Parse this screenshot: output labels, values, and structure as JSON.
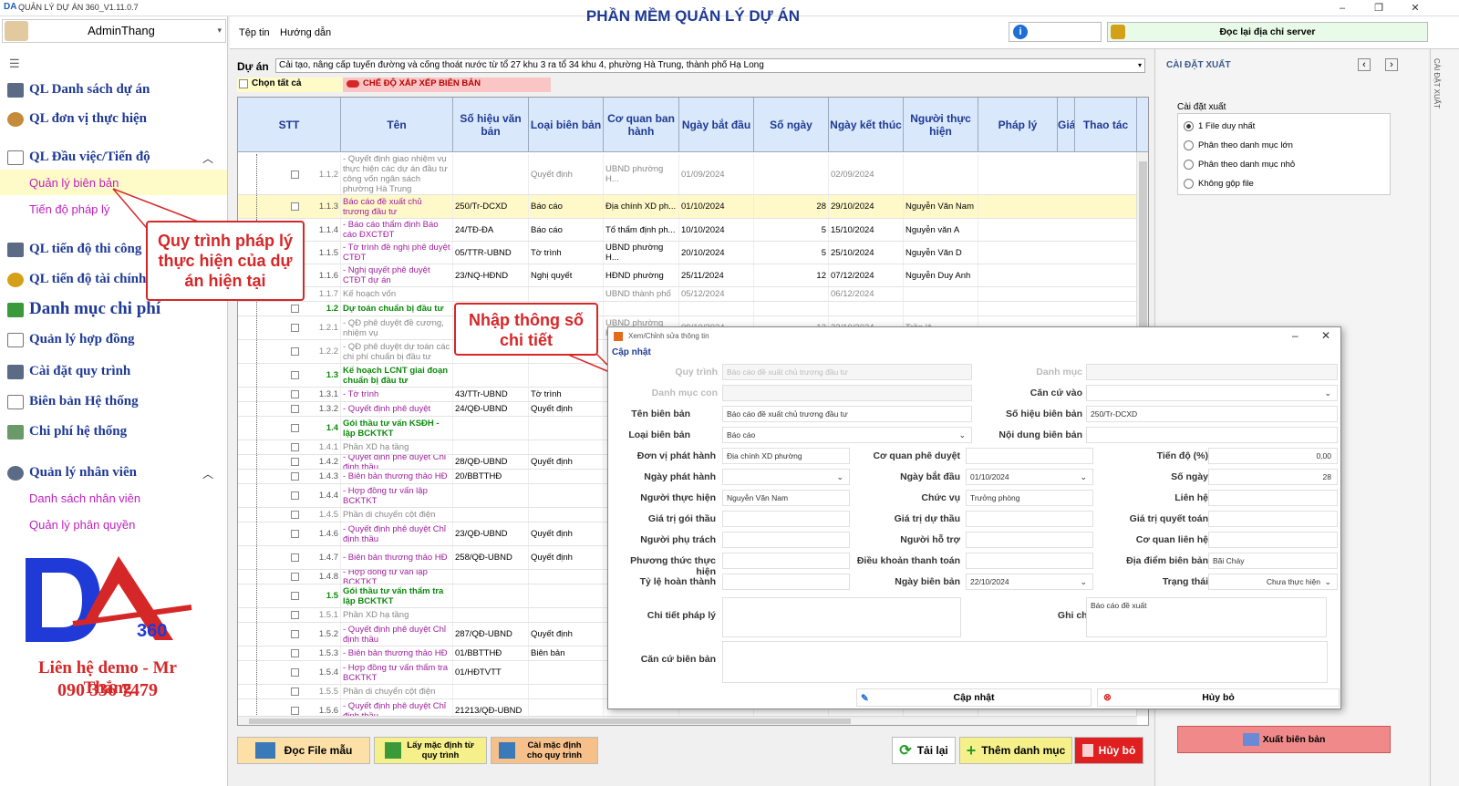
{
  "window": {
    "title": "QUẢN LÝ DỰ ÁN 360_V1.11.0.7",
    "minimize": "–",
    "maximize": "❐",
    "close": "✕"
  },
  "user": {
    "name": "AdminThang"
  },
  "topmenu": {
    "file": "Tệp tin",
    "help": "Hướng dẫn",
    "title": "PHẦN MỀM QUẢN LÝ DỰ ÁN",
    "server_btn": "Đọc lại địa chỉ server"
  },
  "sidebar": {
    "projects": "QL Danh sách dự án",
    "units": "QL đơn vị thực hiện",
    "tasks": "QL Đầu việc/Tiến độ",
    "minutes": "Quản lý biên bản",
    "legal": "Tiến độ pháp lý",
    "construction": "QL tiến độ thi công",
    "finance": "QL tiến độ tài chính",
    "costs": "Danh mục chi phí",
    "contracts": "Quản lý hợp đồng",
    "process": "Cài đặt quy trình",
    "sysminutes": "Biên bản Hệ thống",
    "syscost": "Chi phí hệ thống",
    "staff": "Quản lý nhân viên",
    "stafflist": "Danh sách nhân viên",
    "perm": "Quản lý phân quyền",
    "contact1": "Liên hệ demo - Mr Thắng",
    "contact2": "090 336 7479",
    "logo_num": "360"
  },
  "callouts": {
    "left": "Quy trình pháp lý thực hiện của dự án hiện tại",
    "mid": "Nhập thông số chi tiết"
  },
  "project": {
    "label": "Dự án",
    "value": "Cải tạo, nâng cấp tuyến đường và cống thoát nước từ tổ 27 khu 3 ra tổ 34 khu 4, phường Hà Trung, thành phố Hạ Long",
    "select_all": "Chọn tất cả",
    "sort_mode": "CHẾ ĐỘ XẮP XẾP BIÊN BẢN"
  },
  "grid": {
    "headers": [
      "STT",
      "Tên",
      "Số hiệu văn bản",
      "Loại biên bản",
      "Cơ quan ban hành",
      "Ngày bắt đầu",
      "Số ngày",
      "Ngày kết thúc",
      "Người thực hiện",
      "Pháp lý",
      "Giá",
      "Thao tác"
    ],
    "rows": [
      {
        "stt": "1.1.2",
        "name": "- Quyết định giao nhiệm vụ thực hiện các dự án đầu tư công vốn ngân sách phường Hà Trung",
        "so": "",
        "loai": "Quyết định",
        "cq": "UBND phường H...",
        "nbd": "01/09/2024",
        "sn": "",
        "nkt": "02/09/2024",
        "nth": "",
        "t": "grey"
      },
      {
        "stt": "1.1.3",
        "name": "Báo cáo đề xuất chủ trương đầu tư",
        "so": "250/Tr-DCXD",
        "loai": "Báo cáo",
        "cq": "Địa chính XD ph...",
        "nbd": "01/10/2024",
        "sn": "28",
        "nkt": "29/10/2024",
        "nth": "Nguyễn Văn Nam",
        "t": "hl"
      },
      {
        "stt": "1.1.4",
        "name": "- Báo cáo thẩm định Báo cáo ĐXCTĐT",
        "so": "24/TĐ-ĐA",
        "loai": "Báo cáo",
        "cq": "Tổ thẩm định ph...",
        "nbd": "10/10/2024",
        "sn": "5",
        "nkt": "15/10/2024",
        "nth": "Nguyễn văn A",
        "t": ""
      },
      {
        "stt": "1.1.5",
        "name": "- Tờ trình đề nghị phê duyệt CTĐT",
        "so": "05/TTR-UBND",
        "loai": "Tờ trình",
        "cq": "UBND phường H...",
        "nbd": "20/10/2024",
        "sn": "5",
        "nkt": "25/10/2024",
        "nth": "Nguyễn Văn D",
        "t": ""
      },
      {
        "stt": "1.1.6",
        "name": "- Nghị quyết phê duyệt CTĐT dự án",
        "so": "23/NQ-HĐND",
        "loai": "Nghị quyết",
        "cq": "HĐND phường",
        "nbd": "25/11/2024",
        "sn": "12",
        "nkt": "07/12/2024",
        "nth": "Nguyễn Duy Anh",
        "t": ""
      },
      {
        "stt": "1.1.7",
        "name": "Kế hoạch vốn",
        "so": "",
        "loai": "",
        "cq": "UBND thành phố",
        "nbd": "05/12/2024",
        "sn": "",
        "nkt": "06/12/2024",
        "nth": "",
        "t": "grey"
      },
      {
        "stt": "1.2",
        "name": "Dự toán chuẩn bị đầu tư",
        "so": "",
        "loai": "",
        "cq": "",
        "nbd": "",
        "sn": "",
        "nkt": "",
        "nth": "",
        "t": "grp"
      },
      {
        "stt": "1.2.1",
        "name": "- QĐ phê duyệt đề cương, nhiệm vụ",
        "so": "",
        "loai": "",
        "cq": "UBND phường H...",
        "nbd": "09/10/2024",
        "sn": "13",
        "nkt": "22/10/2024",
        "nth": "Trần lệ",
        "t": "grey"
      },
      {
        "stt": "1.2.2",
        "name": "- QĐ phê duyệt dự toán các chi phí chuẩn bị đầu tư",
        "so": "",
        "loai": "",
        "cq": "",
        "nbd": "",
        "sn": "",
        "nkt": "",
        "nth": "",
        "t": "grey"
      },
      {
        "stt": "1.3",
        "name": "Kế hoạch LCNT giai đoạn chuẩn bị đầu tư",
        "so": "",
        "loai": "",
        "cq": "",
        "nbd": "",
        "sn": "",
        "nkt": "",
        "nth": "",
        "t": "grp"
      },
      {
        "stt": "1.3.1",
        "name": "- Tờ trình",
        "so": "43/TTr-UBND",
        "loai": "Tờ trình",
        "cq": "",
        "nbd": "",
        "sn": "",
        "nkt": "",
        "nth": "",
        "t": ""
      },
      {
        "stt": "1.3.2",
        "name": "- Quyết định phê duyệt",
        "so": "24/QĐ-UBND",
        "loai": "Quyết định",
        "cq": "",
        "nbd": "",
        "sn": "",
        "nkt": "",
        "nth": "",
        "t": ""
      },
      {
        "stt": "1.4",
        "name": "Gói thầu tư vấn KSĐH - lập BCKTKT",
        "so": "",
        "loai": "",
        "cq": "",
        "nbd": "",
        "sn": "",
        "nkt": "",
        "nth": "",
        "t": "grp"
      },
      {
        "stt": "1.4.1",
        "name": "Phần XD hạ tầng",
        "so": "",
        "loai": "",
        "cq": "",
        "nbd": "",
        "sn": "",
        "nkt": "",
        "nth": "",
        "t": "grey"
      },
      {
        "stt": "1.4.2",
        "name": "- Quyết định phê duyệt Chỉ định thầu",
        "so": "28/QĐ-UBND",
        "loai": "Quyết định",
        "cq": "",
        "nbd": "",
        "sn": "",
        "nkt": "",
        "nth": "",
        "t": ""
      },
      {
        "stt": "1.4.3",
        "name": "- Biên bản thương thảo HĐ",
        "so": "20/BBTTHĐ",
        "loai": "",
        "cq": "",
        "nbd": "",
        "sn": "",
        "nkt": "",
        "nth": "",
        "t": ""
      },
      {
        "stt": "1.4.4",
        "name": "- Hợp đồng tư vấn lập BCKTKT",
        "so": "",
        "loai": "",
        "cq": "",
        "nbd": "",
        "sn": "",
        "nkt": "",
        "nth": "",
        "t": ""
      },
      {
        "stt": "1.4.5",
        "name": "Phần di chuyển cột điện",
        "so": "",
        "loai": "",
        "cq": "",
        "nbd": "",
        "sn": "",
        "nkt": "",
        "nth": "",
        "t": "grey"
      },
      {
        "stt": "1.4.6",
        "name": "- Quyết định phê duyệt Chỉ định thầu",
        "so": "23/QĐ-UBND",
        "loai": "Quyết định",
        "cq": "",
        "nbd": "",
        "sn": "",
        "nkt": "",
        "nth": "",
        "t": ""
      },
      {
        "stt": "1.4.7",
        "name": "- Biên bản thương thảo HĐ",
        "so": "258/QĐ-UBND",
        "loai": "Quyết định",
        "cq": "",
        "nbd": "",
        "sn": "",
        "nkt": "",
        "nth": "",
        "t": ""
      },
      {
        "stt": "1.4.8",
        "name": "- Hợp đồng tư vấn lập BCKTKT",
        "so": "",
        "loai": "",
        "cq": "",
        "nbd": "",
        "sn": "",
        "nkt": "",
        "nth": "",
        "t": ""
      },
      {
        "stt": "1.5",
        "name": "Gói thầu tư vấn thẩm tra lập BCKTKT",
        "so": "",
        "loai": "",
        "cq": "",
        "nbd": "",
        "sn": "",
        "nkt": "",
        "nth": "",
        "t": "grp"
      },
      {
        "stt": "1.5.1",
        "name": "Phần XD hạ tầng",
        "so": "",
        "loai": "",
        "cq": "",
        "nbd": "",
        "sn": "",
        "nkt": "",
        "nth": "",
        "t": "grey"
      },
      {
        "stt": "1.5.2",
        "name": "- Quyết định phê duyệt Chỉ định thầu",
        "so": "287/QĐ-UBND",
        "loai": "Quyết định",
        "cq": "",
        "nbd": "",
        "sn": "",
        "nkt": "",
        "nth": "",
        "t": ""
      },
      {
        "stt": "1.5.3",
        "name": "- Biên bản thương thảo HĐ",
        "so": "01/BBTTHĐ",
        "loai": "Biên bản",
        "cq": "",
        "nbd": "",
        "sn": "",
        "nkt": "",
        "nth": "",
        "t": ""
      },
      {
        "stt": "1.5.4",
        "name": "- Hợp đồng tư vấn thẩm tra BCKTKT",
        "so": "01/HĐTVTT",
        "loai": "",
        "cq": "",
        "nbd": "",
        "sn": "",
        "nkt": "",
        "nth": "",
        "t": ""
      },
      {
        "stt": "1.5.5",
        "name": "Phần di chuyển cột điện",
        "so": "",
        "loai": "",
        "cq": "",
        "nbd": "",
        "sn": "",
        "nkt": "",
        "nth": "",
        "t": "grey"
      },
      {
        "stt": "1.5.6",
        "name": "- Quyết định phê duyệt Chỉ định thầu",
        "so": "21213/QĐ-UBND",
        "loai": "",
        "cq": "",
        "nbd": "",
        "sn": "",
        "nkt": "",
        "nth": "",
        "t": ""
      }
    ]
  },
  "bottom": {
    "read_tpl": "Đọc File mẫu",
    "get_default": "Lấy mặc định từ quy trình",
    "set_default": "Cài mặc định cho quy trình",
    "reload": "Tải lại",
    "add": "Thêm danh mục",
    "cancel": "Hủy bỏ"
  },
  "export": {
    "title": "CÀI ĐẶT XUẤT",
    "vtitle": "CÀI ĐẶT XUẤT",
    "group": "Cài đặt xuất",
    "opts": [
      "1 File duy nhất",
      "Phân theo danh mục lớn",
      "Phân theo danh mục nhỏ",
      "Không gộp file"
    ],
    "btn": "Xuất biên bản"
  },
  "dialog": {
    "title": "Xem/Chỉnh sửa thông tin",
    "section": "Cập nhật",
    "f": {
      "quytrinh": {
        "l": "Quy trình",
        "v": "Báo cáo đề xuất chủ trương đầu tư"
      },
      "danhmuc": {
        "l": "Danh mục",
        "v": ""
      },
      "danhmuccon": {
        "l": "Danh mục con",
        "v": ""
      },
      "cancu": {
        "l": "Căn cứ vào",
        "v": ""
      },
      "ten": {
        "l": "Tên biên bản",
        "v": "Báo cáo đề xuất chủ trương đầu tư"
      },
      "sohieu": {
        "l": "Số hiệu biên bản",
        "v": "250/Tr-DCXD"
      },
      "loai": {
        "l": "Loại biên bản",
        "v": "Báo cáo"
      },
      "noidung": {
        "l": "Nội dung biên bản",
        "v": ""
      },
      "donvi": {
        "l": "Đơn vị phát hành",
        "v": "Địa chính XD phường"
      },
      "cqpd": {
        "l": "Cơ quan phê duyệt",
        "v": ""
      },
      "tiendo": {
        "l": "Tiến độ (%)",
        "v": "0,00"
      },
      "ngayph": {
        "l": "Ngày phát hành",
        "v": ""
      },
      "ngaybd": {
        "l": "Ngày bắt đầu",
        "v": "01/10/2024"
      },
      "songay": {
        "l": "Số ngày",
        "v": "28"
      },
      "nguoith": {
        "l": "Người thực hiện",
        "v": "Nguyễn Văn Nam"
      },
      "chucvu": {
        "l": "Chức vụ",
        "v": "Trưởng phòng"
      },
      "lienhe": {
        "l": "Liên hệ",
        "v": ""
      },
      "gtgoi": {
        "l": "Giá trị gói thầu",
        "v": ""
      },
      "gtdu": {
        "l": "Giá trị dự thầu",
        "v": ""
      },
      "gtqt": {
        "l": "Giá trị quyết toán",
        "v": ""
      },
      "nguoipt": {
        "l": "Người phụ trách",
        "v": ""
      },
      "nguoiht": {
        "l": "Người hỗ trợ",
        "v": ""
      },
      "cqlh": {
        "l": "Cơ quan liên hệ",
        "v": ""
      },
      "ptth": {
        "l": "Phương thức thực hiện",
        "v": ""
      },
      "dktt": {
        "l": "Điều khoản thanh toán",
        "v": ""
      },
      "diadiem": {
        "l": "Địa điểm biên bản",
        "v": "Bãi Cháy"
      },
      "tyle": {
        "l": "Tỷ lệ hoàn thành",
        "v": ""
      },
      "ngaybb": {
        "l": "Ngày biên bản",
        "v": "22/10/2024"
      },
      "trangthai": {
        "l": "Trạng thái",
        "v": "Chưa thực hiện"
      },
      "chitiet": {
        "l": "Chi tiết pháp lý",
        "v": ""
      },
      "ghichu": {
        "l": "Ghi chú",
        "v": "Báo cáo đề xuất"
      },
      "cancubb": {
        "l": "Căn cứ biên bản",
        "v": ""
      }
    },
    "update": "Cập nhật",
    "cancel": "Hủy bỏ"
  }
}
